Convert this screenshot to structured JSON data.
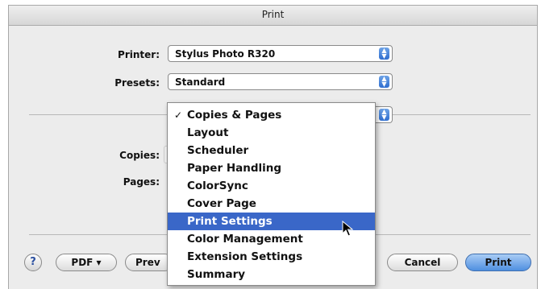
{
  "window": {
    "title": "Print"
  },
  "printer": {
    "label": "Printer:",
    "value": "Stylus Photo R320"
  },
  "presets": {
    "label": "Presets:",
    "value": "Standard"
  },
  "copies": {
    "label": "Copies:"
  },
  "pages": {
    "label": "Pages:"
  },
  "menu": {
    "items": [
      {
        "label": "Copies & Pages",
        "checked": true
      },
      {
        "label": "Layout"
      },
      {
        "label": "Scheduler"
      },
      {
        "label": "Paper Handling"
      },
      {
        "label": "ColorSync"
      },
      {
        "label": "Cover Page"
      },
      {
        "label": "Print Settings",
        "highlighted": true
      },
      {
        "label": "Color Management"
      },
      {
        "label": "Extension Settings"
      },
      {
        "label": "Summary"
      }
    ],
    "check_glyph": "✓"
  },
  "footer": {
    "help": "?",
    "pdf_button": "PDF ▾",
    "preview_button": "Prev",
    "cancel_button": "Cancel",
    "print_button": "Print"
  }
}
